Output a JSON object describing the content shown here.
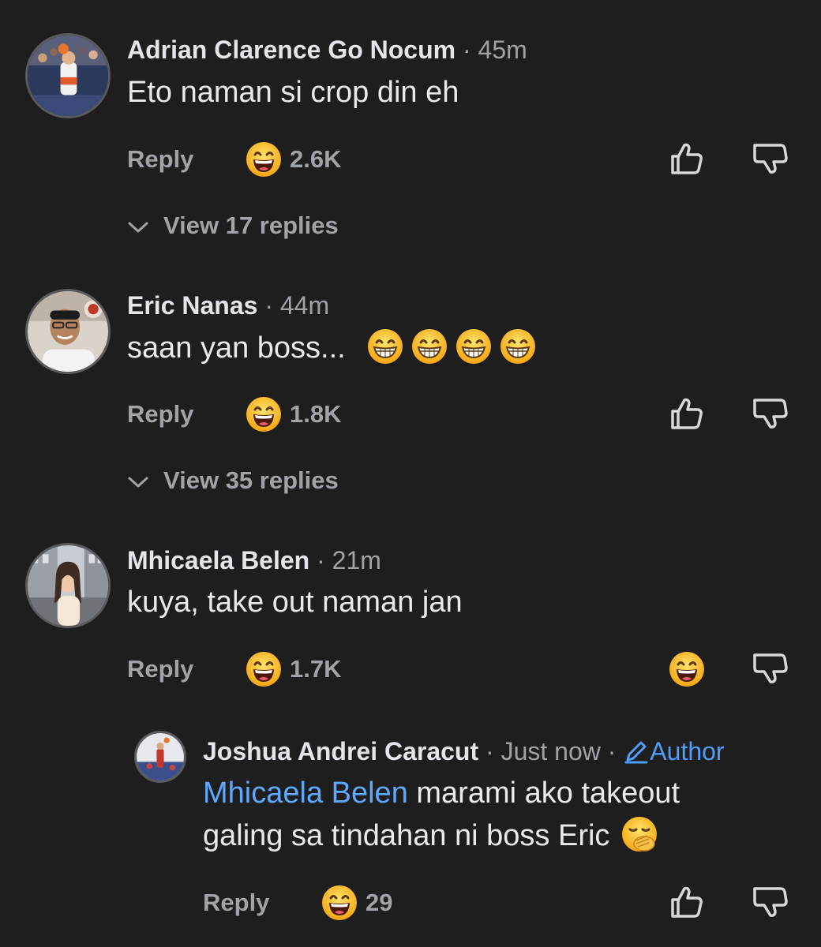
{
  "comments": [
    {
      "author": "Adrian Clarence Go Nocum",
      "separator": "·",
      "time": "45m",
      "text": "Eto naman si crop din eh",
      "reply_label": "Reply",
      "reaction_count": "2.6K",
      "view_replies": "View 17 replies"
    },
    {
      "author": "Eric Nanas",
      "separator": "·",
      "time": "44m",
      "text": "saan yan boss...",
      "reply_label": "Reply",
      "reaction_count": "1.8K",
      "view_replies": "View 35 replies"
    },
    {
      "author": "Mhicaela Belen",
      "separator": "·",
      "time": "21m",
      "text": "kuya, take out naman jan",
      "reply_label": "Reply",
      "reaction_count": "1.7K"
    }
  ],
  "reply": {
    "author": "Joshua Andrei Caracut",
    "separator": "·",
    "time": "Just now",
    "separator2": "·",
    "badge": "Author",
    "mention": "Mhicaela Belen",
    "text_line1": " marami ako takeout",
    "text_line2": "galing sa tindahan ni boss Eric",
    "reply_label": "Reply",
    "reaction_count": "29"
  },
  "icons": {
    "reaction": "laughing-emoji-icon",
    "grin": "grinning-emoji-icon",
    "hand_over_mouth": "hand-over-mouth-emoji-icon",
    "upvote": "thumbs-up-outline-icon",
    "downvote": "thumbs-down-outline-icon",
    "chevron": "chevron-down-icon",
    "pencil": "pencil-icon"
  },
  "colors": {
    "background": "#1e1e1f",
    "mention": "#5fa8ff",
    "author_badge": "#4e9dfc",
    "muted": "#a0a3a8"
  }
}
